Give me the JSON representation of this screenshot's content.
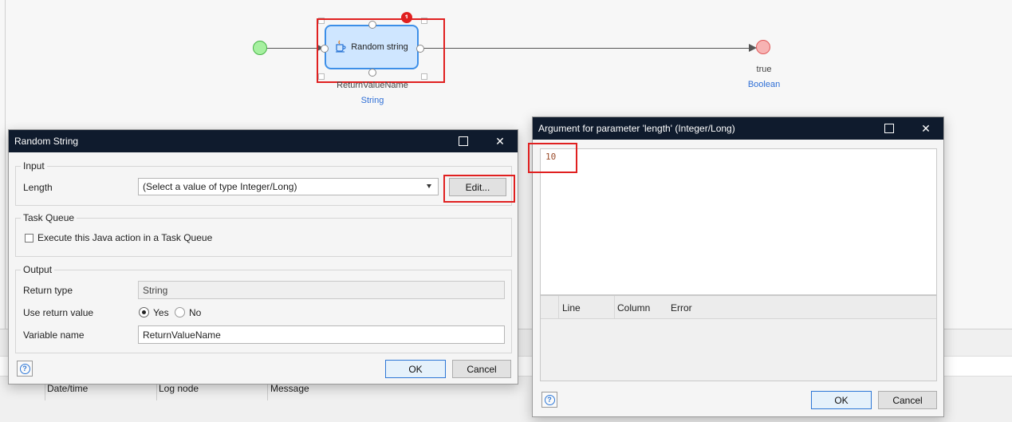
{
  "canvas": {
    "node": {
      "label": "Random string",
      "badge": "1",
      "output_name": "ReturnValueName",
      "output_type": "String"
    },
    "end": {
      "label": "true",
      "type": "Boolean"
    }
  },
  "log": {
    "columns": [
      "Date/time",
      "Log node",
      "Message"
    ]
  },
  "random_string_dialog": {
    "title": "Random String",
    "input": {
      "group_title": "Input",
      "length_label": "Length",
      "length_select_value": "(Select a value of type Integer/Long)",
      "edit_button": "Edit..."
    },
    "task_queue": {
      "group_title": "Task Queue",
      "checkbox_label": "Execute this Java action in a Task Queue"
    },
    "output": {
      "group_title": "Output",
      "return_type_label": "Return type",
      "return_type_value": "String",
      "use_return_label": "Use return value",
      "yes_label": "Yes",
      "no_label": "No",
      "variable_name_label": "Variable name",
      "variable_name_value": "ReturnValueName"
    },
    "ok": "OK",
    "cancel": "Cancel",
    "help": "?"
  },
  "argument_dialog": {
    "title": "Argument for parameter 'length' (Integer/Long)",
    "expression": "10",
    "error_columns": [
      "Line",
      "Column",
      "Error"
    ],
    "ok": "OK",
    "cancel": "Cancel",
    "help": "?"
  },
  "colors": {
    "titlebar": "#0f1b2d",
    "highlight": "#e02020",
    "node_fill": "#cfe6ff",
    "node_border": "#3d8fe8",
    "link": "#2f6fd6"
  }
}
